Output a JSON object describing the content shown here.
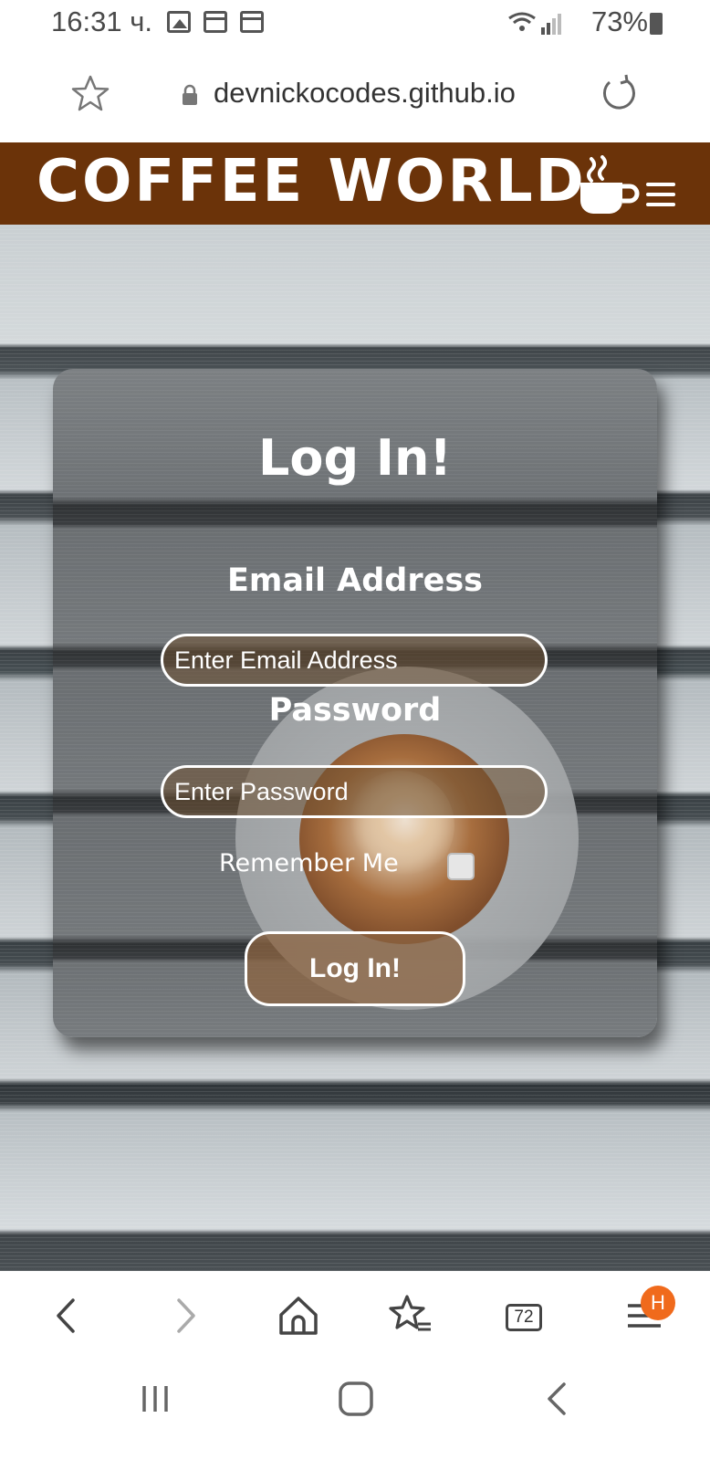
{
  "status_bar": {
    "time": "16:31 ч.",
    "battery": "73%"
  },
  "browser": {
    "url": "devnickocodes.github.io",
    "tab_count": "72",
    "menu_badge": "H"
  },
  "site": {
    "title": "COFFEE WORLD"
  },
  "login": {
    "heading": "Log In!",
    "email_label": "Email Address",
    "email_placeholder": "Enter Email Address",
    "password_label": "Password",
    "password_placeholder": "Enter Password",
    "remember_label": "Remember Me",
    "remember_checked": false,
    "submit_label": "Log In!"
  },
  "colors": {
    "header_brown": "#6b3309",
    "badge_orange": "#f06a1c"
  },
  "icons": {
    "status_left": [
      "gallery-icon",
      "calendar-icon",
      "calendar-icon"
    ],
    "status_right": [
      "wifi-icon",
      "signal-icon",
      "battery-icon"
    ],
    "url_bar": [
      "bookmark-star-icon",
      "lock-icon",
      "reload-icon"
    ],
    "header": [
      "coffee-cup-icon",
      "hamburger-menu-icon"
    ],
    "bottom_bar": [
      "back-icon",
      "forward-icon",
      "home-icon",
      "bookmarks-icon",
      "tabs-icon",
      "menu-icon"
    ],
    "nav_bar": [
      "recent-apps-icon",
      "home-button-icon",
      "system-back-icon"
    ]
  }
}
